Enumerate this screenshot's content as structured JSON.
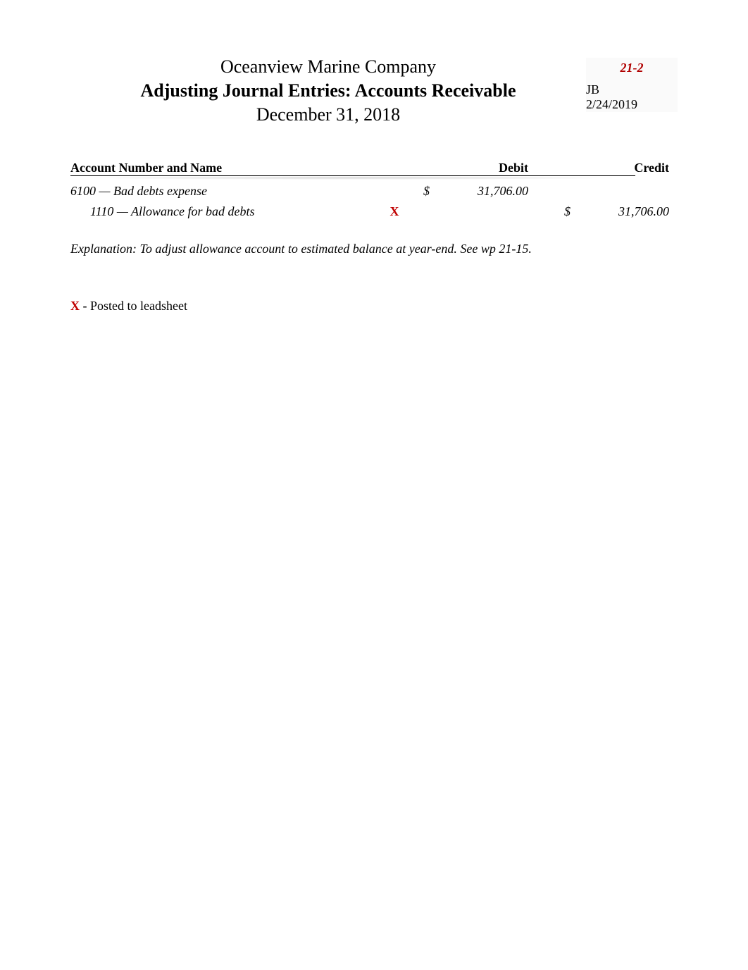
{
  "header": {
    "company": "Oceanview Marine Company",
    "title": "Adjusting Journal Entries: Accounts Receivable",
    "date": "December 31, 2018"
  },
  "ref": {
    "code": "21-2",
    "initials": "JB",
    "prep_date": "2/24/2019"
  },
  "table": {
    "headers": {
      "account": "Account Number and Name",
      "debit": "Debit",
      "credit": "Credit"
    },
    "rows": [
      {
        "account": "6100 — Bad debts expense",
        "mark": "",
        "debit_currency": "$",
        "debit": "31,706.00",
        "credit_currency": "",
        "credit": ""
      },
      {
        "account": "1110 — Allowance for bad debts",
        "mark": "X",
        "debit_currency": "",
        "debit": "",
        "credit_currency": "$",
        "credit": "31,706.00"
      }
    ]
  },
  "explanation": "Explanation:  To adjust allowance account to estimated balance at year-end. See wp 21-15.",
  "legend": {
    "mark": "X",
    "text": " - Posted to leadsheet"
  }
}
